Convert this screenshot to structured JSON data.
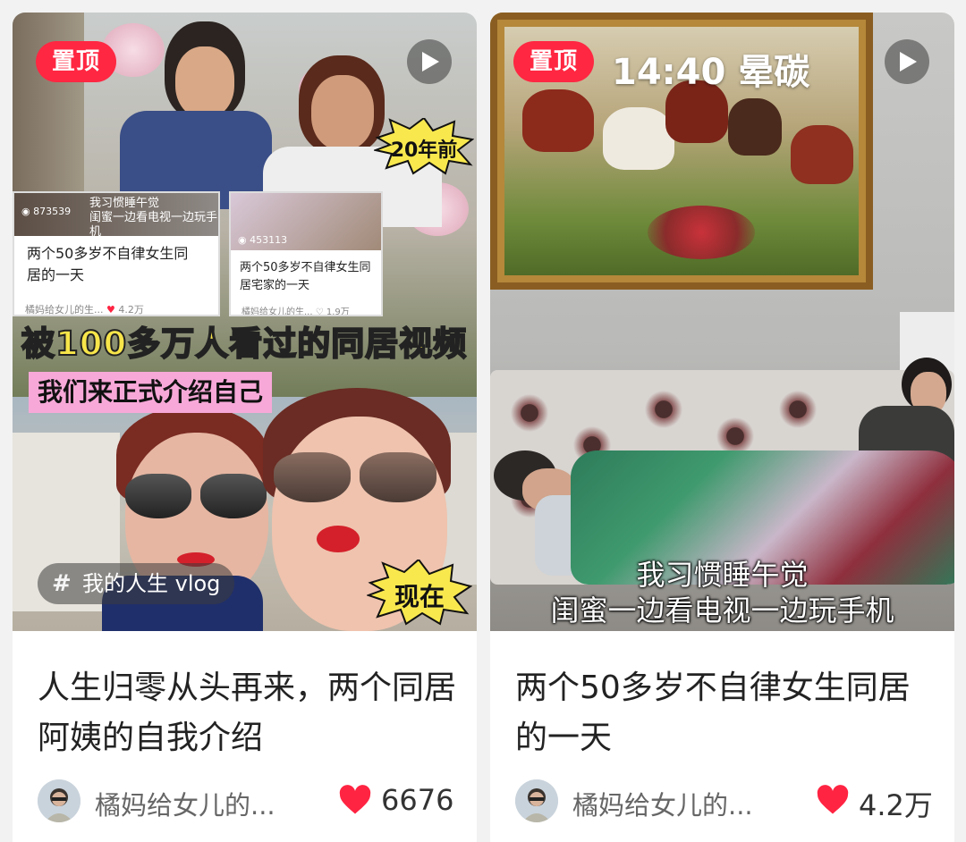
{
  "cards": [
    {
      "pin_label": "置顶",
      "title": "人生归零从头再来，两个同居阿姨的自我介绍",
      "author": "橘妈给女儿的...",
      "likes": "6676",
      "cover": {
        "badge_top": "20年前",
        "banner_line1": "被100多万人看过的同居视频",
        "banner_line2": "我们来正式介绍自己",
        "badge_bottom": "现在",
        "topic": "我的人生 vlog",
        "mini_cards": [
          {
            "views": "873539",
            "subtitle_1": "我习惯睡午觉",
            "subtitle_2": "闺蜜一边看电视一边玩手机",
            "title_line1": "两个50多岁不自律女生同",
            "title_line2": "居的一天",
            "author": "橘妈给女儿的生...",
            "likes": "4.2万"
          },
          {
            "views": "453113",
            "title_line1": "两个50多岁不自律女生同",
            "title_line2": "居宅家的一天",
            "author": "橘妈给女儿的生...",
            "likes": "1.9万"
          }
        ]
      }
    },
    {
      "pin_label": "置顶",
      "title": "两个50多岁不自律女生同居的一天",
      "author": "橘妈给女儿的...",
      "likes": "4.2万",
      "cover": {
        "time_label": "14:40 晕碳",
        "subtitle_1": "我习惯睡午觉",
        "subtitle_2": "闺蜜一边看电视一边玩手机"
      }
    }
  ],
  "colors": {
    "pin": "#ff2742",
    "like": "#ff2442",
    "banner_text": "#f7e54a",
    "banner_pink": "#f7a8d8"
  },
  "icons": [
    "play-icon",
    "heart-icon",
    "hashtag-icon",
    "eye-icon"
  ]
}
